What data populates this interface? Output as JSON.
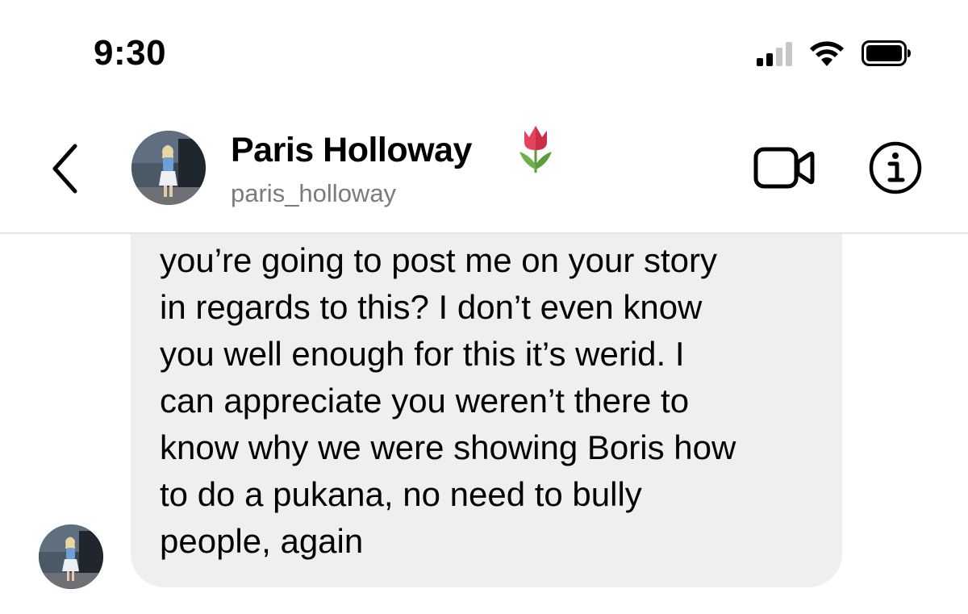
{
  "status_bar": {
    "time": "9:30",
    "signal_icon": "cellular-signal-icon",
    "wifi_icon": "wifi-icon",
    "battery_icon": "battery-icon"
  },
  "header": {
    "back_icon": "chevron-left-icon",
    "contact_name": "Paris Holloway",
    "name_emoji_icon": "tulip-icon",
    "username": "paris_holloway",
    "video_icon": "video-camera-icon",
    "info_icon": "info-icon"
  },
  "messages": [
    {
      "sender": "Paris Holloway",
      "text": "you’re going to post me on your story\nin regards to this? I don’t even know\nyou well enough for this it’s werid. I\ncan appreciate you weren’t there to\nknow why we were showing Boris how\nto do a pukana, no need to bully\npeople, again"
    }
  ],
  "colors": {
    "bubble": "#efefef",
    "username": "#7b7b7f",
    "divider": "#e4e4e6"
  }
}
